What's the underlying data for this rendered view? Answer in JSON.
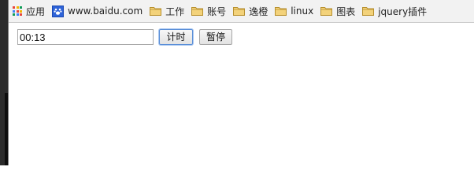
{
  "bookmarks_bar": {
    "items": [
      {
        "label": "应用",
        "icon": "apps-grid-icon"
      },
      {
        "label": "www.baidu.com",
        "icon": "baidu-paw-icon"
      },
      {
        "label": "工作",
        "icon": "folder-icon"
      },
      {
        "label": "账号",
        "icon": "folder-icon"
      },
      {
        "label": "逸橙",
        "icon": "folder-icon"
      },
      {
        "label": "linux",
        "icon": "folder-icon"
      },
      {
        "label": "图表",
        "icon": "folder-icon"
      },
      {
        "label": "jquery插件",
        "icon": "folder-icon"
      }
    ]
  },
  "timer": {
    "value": "00:13",
    "start_label": "计时",
    "pause_label": "暂停"
  },
  "colors": {
    "apps_grid": [
      "#e8453c",
      "#f4b400",
      "#0f9d58",
      "#4285f4",
      "#e8453c",
      "#f4b400",
      "#0f9d58",
      "#4285f4",
      "#e8453c"
    ],
    "baidu_blue": "#2e63d8",
    "folder_fill": "#f3d27a",
    "folder_stroke": "#b8902e",
    "focus_border": "#5a8fd8"
  }
}
